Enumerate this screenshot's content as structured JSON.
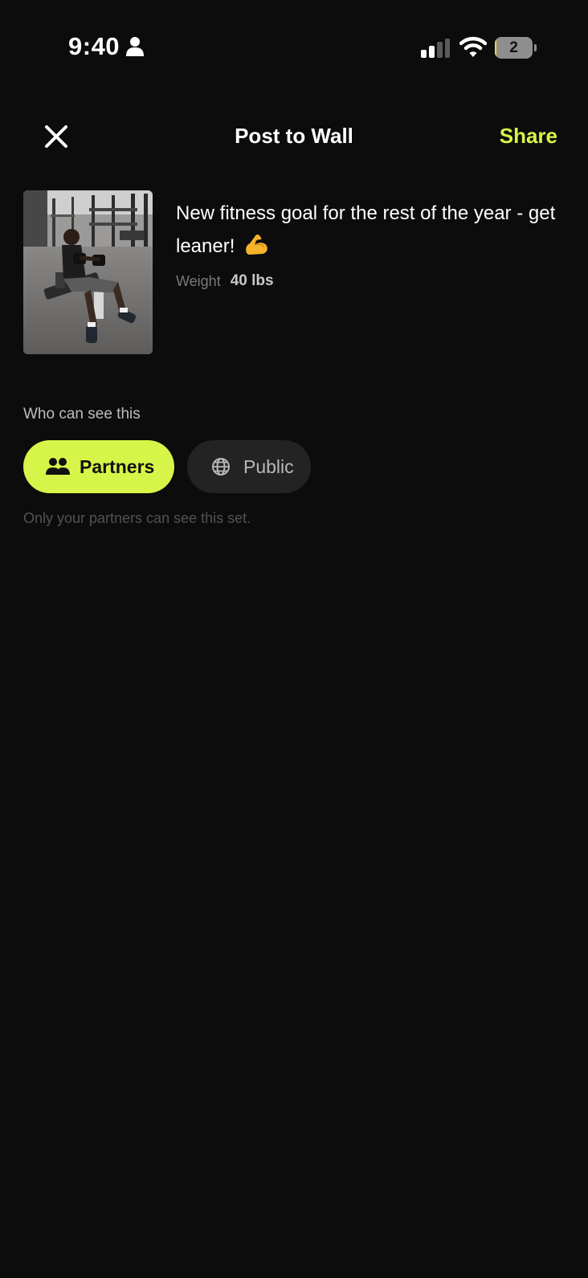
{
  "status_bar": {
    "time": "9:40",
    "battery_level": "2",
    "battery_fraction": 0.04,
    "icons": [
      "person-icon",
      "cellular-signal-icon",
      "wifi-icon",
      "battery-icon"
    ]
  },
  "nav": {
    "title": "Post to Wall",
    "share_label": "Share",
    "close_icon": "close-icon"
  },
  "post": {
    "caption": "New fitness goal for the rest of the year - get leaner!",
    "caption_emoji": "flexed-biceps-icon",
    "meta_label": "Weight",
    "meta_value": "40 lbs",
    "image_alt": "gym-photo"
  },
  "visibility": {
    "label": "Who can see this",
    "options": [
      {
        "label": "Partners",
        "icon": "people-icon",
        "selected": true
      },
      {
        "label": "Public",
        "icon": "globe-icon",
        "selected": false
      }
    ],
    "hint": "Only your partners can see this set."
  },
  "colors": {
    "background": "#0c0c0c",
    "accent": "#d6f548",
    "pill_inactive": "#232323"
  }
}
